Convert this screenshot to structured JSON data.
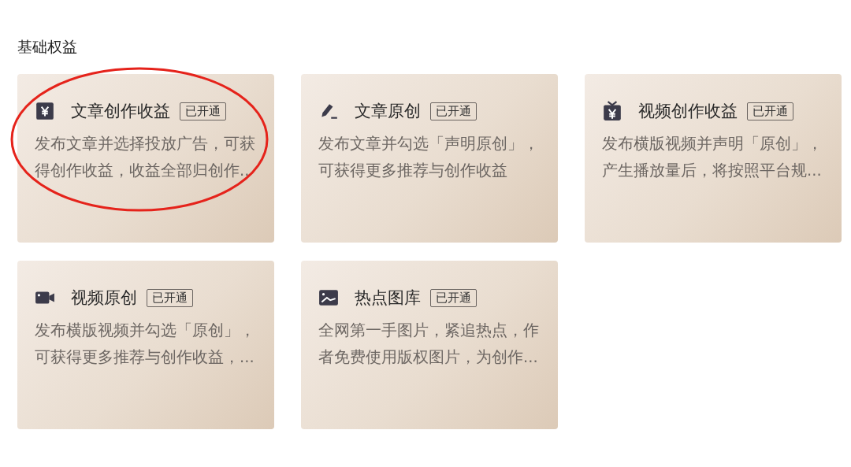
{
  "section_title": "基础权益",
  "cards": [
    {
      "kind": "yen",
      "title": "文章创作收益",
      "badge": "已开通",
      "description": "发布文章并选择投放广告，可获得创作收益，收益全部归创作..",
      "circled": true
    },
    {
      "kind": "pen",
      "title": "文章原创",
      "badge": "已开通",
      "description": "发布文章并勾选「声明原创」，可获得更多推荐与创作收益",
      "circled": false
    },
    {
      "kind": "tv",
      "title": "视频创作收益",
      "badge": "已开通",
      "description": "发布横版视频并声明「原创」，产生播放量后，将按照平台规...",
      "circled": false
    },
    {
      "kind": "camera",
      "title": "视频原创",
      "badge": "已开通",
      "description": "发布横版视频并勾选「原创」，可获得更多推荐与创作收益，...",
      "circled": false
    },
    {
      "kind": "image",
      "title": "热点图库",
      "badge": "已开通",
      "description": "全网第一手图片，紧追热点，作者免费使用版权图片，为创作...",
      "circled": false
    }
  ]
}
